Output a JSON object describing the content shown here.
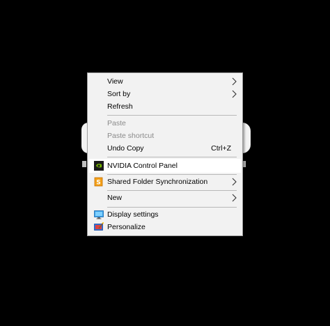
{
  "menu": {
    "items": [
      {
        "label": "View",
        "icon": "",
        "submenu": true
      },
      {
        "label": "Sort by",
        "icon": "",
        "submenu": true
      },
      {
        "label": "Refresh",
        "icon": ""
      },
      {
        "label": "Paste",
        "disabled": true
      },
      {
        "label": "Paste shortcut",
        "disabled": true
      },
      {
        "label": "Undo Copy",
        "shortcut": "Ctrl+Z"
      },
      {
        "label": "NVIDIA Control Panel",
        "icon": "nvidia-icon"
      },
      {
        "label": "Shared Folder Synchronization",
        "icon": "sync-folder-icon",
        "submenu": true
      },
      {
        "label": "New",
        "submenu": true
      },
      {
        "label": "Display settings",
        "icon": "display-icon"
      },
      {
        "label": "Personalize",
        "icon": "personalize-icon"
      }
    ]
  },
  "colors": {
    "menu_bg": "#f2f2f2",
    "highlight": "#ffffff",
    "nvidia_green": "#76b900",
    "disabled_text": "#8a8a8a"
  }
}
